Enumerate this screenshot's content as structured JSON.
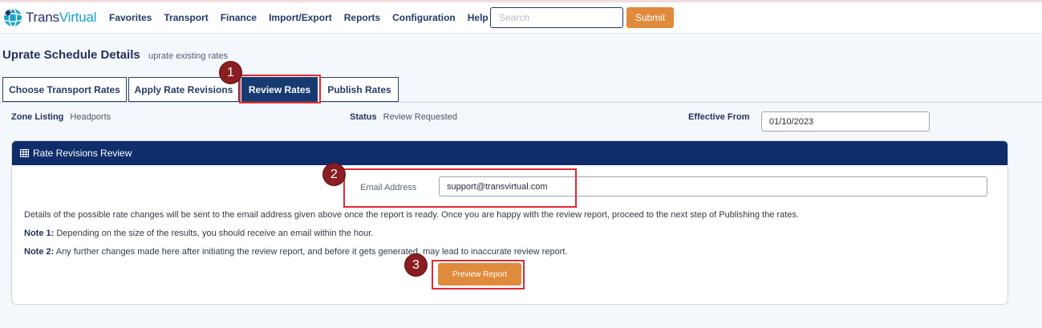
{
  "app": {
    "logo_part1": "Trans",
    "logo_part2": "Virtual",
    "brand_color": "#27326b",
    "accent_color": "#1aa3c9",
    "button_color": "#e08a3c"
  },
  "nav": {
    "items": [
      "Favorites",
      "Transport",
      "Finance",
      "Import/Export",
      "Reports",
      "Configuration",
      "Help"
    ]
  },
  "search": {
    "placeholder": "Search",
    "value": ""
  },
  "header_submit_label": "Submit",
  "page": {
    "title": "Uprate Schedule Details",
    "subtitle": "uprate existing rates"
  },
  "tabs": [
    {
      "label": "Choose Transport Rates",
      "active": false
    },
    {
      "label": "Apply Rate Revisions",
      "active": false
    },
    {
      "label": "Review Rates",
      "active": true
    },
    {
      "label": "Publish Rates",
      "active": false
    }
  ],
  "info": {
    "zone_label": "Zone Listing",
    "zone_value": "Headports",
    "status_label": "Status",
    "status_value": "Review Requested",
    "effective_label": "Effective From",
    "effective_value": "01/10/2023"
  },
  "card": {
    "title": "Rate Revisions Review",
    "icon": "table-icon",
    "email_label": "Email Address",
    "email_value": "support@transvirtual.com",
    "details_text": "Details of the possible rate changes will be sent to the email address given above once the report is ready. Once you are happy with the review report, proceed to the next step of Publishing the rates.",
    "note1_label": "Note 1:",
    "note1_text": " Depending on the size of the results, you should receive an email within the hour.",
    "note2_label": "Note 2:",
    "note2_text": " Any further changes made here after initiating the review report, and before it gets generated, may lead to inaccurate review report.",
    "preview_label": "Preview Report"
  },
  "annotations": [
    "1",
    "2",
    "3"
  ]
}
